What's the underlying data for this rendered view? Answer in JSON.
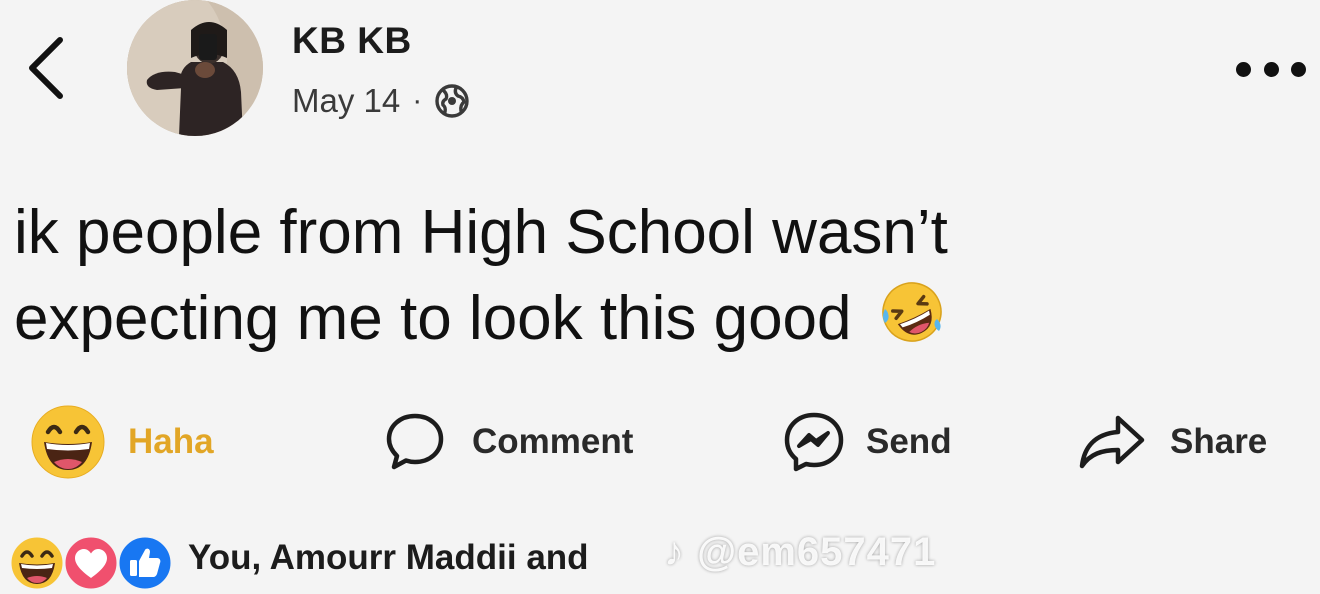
{
  "post": {
    "author_name": "KB KB",
    "date": "May 14",
    "separator": "·",
    "privacy_icon": "globe-icon",
    "text_line1": "ik people from High School wasn’t",
    "text_line2": "expecting me to look this good",
    "text_emoji": "rolling-on-floor-laughing-emoji"
  },
  "actions": {
    "haha_label": "Haha",
    "comment_label": "Comment",
    "send_label": "Send",
    "share_label": "Share"
  },
  "reactions": {
    "icons": [
      "haha-reaction-icon",
      "love-reaction-icon",
      "like-reaction-icon"
    ],
    "summary": "You, Amourr Maddii and"
  },
  "watermark": {
    "text": "♪ @em657471"
  },
  "colors": {
    "haha_active": "#e2a626",
    "like_blue": "#1877f2",
    "love_pink": "#f0506e",
    "emoji_yellow": "#f7c436"
  }
}
